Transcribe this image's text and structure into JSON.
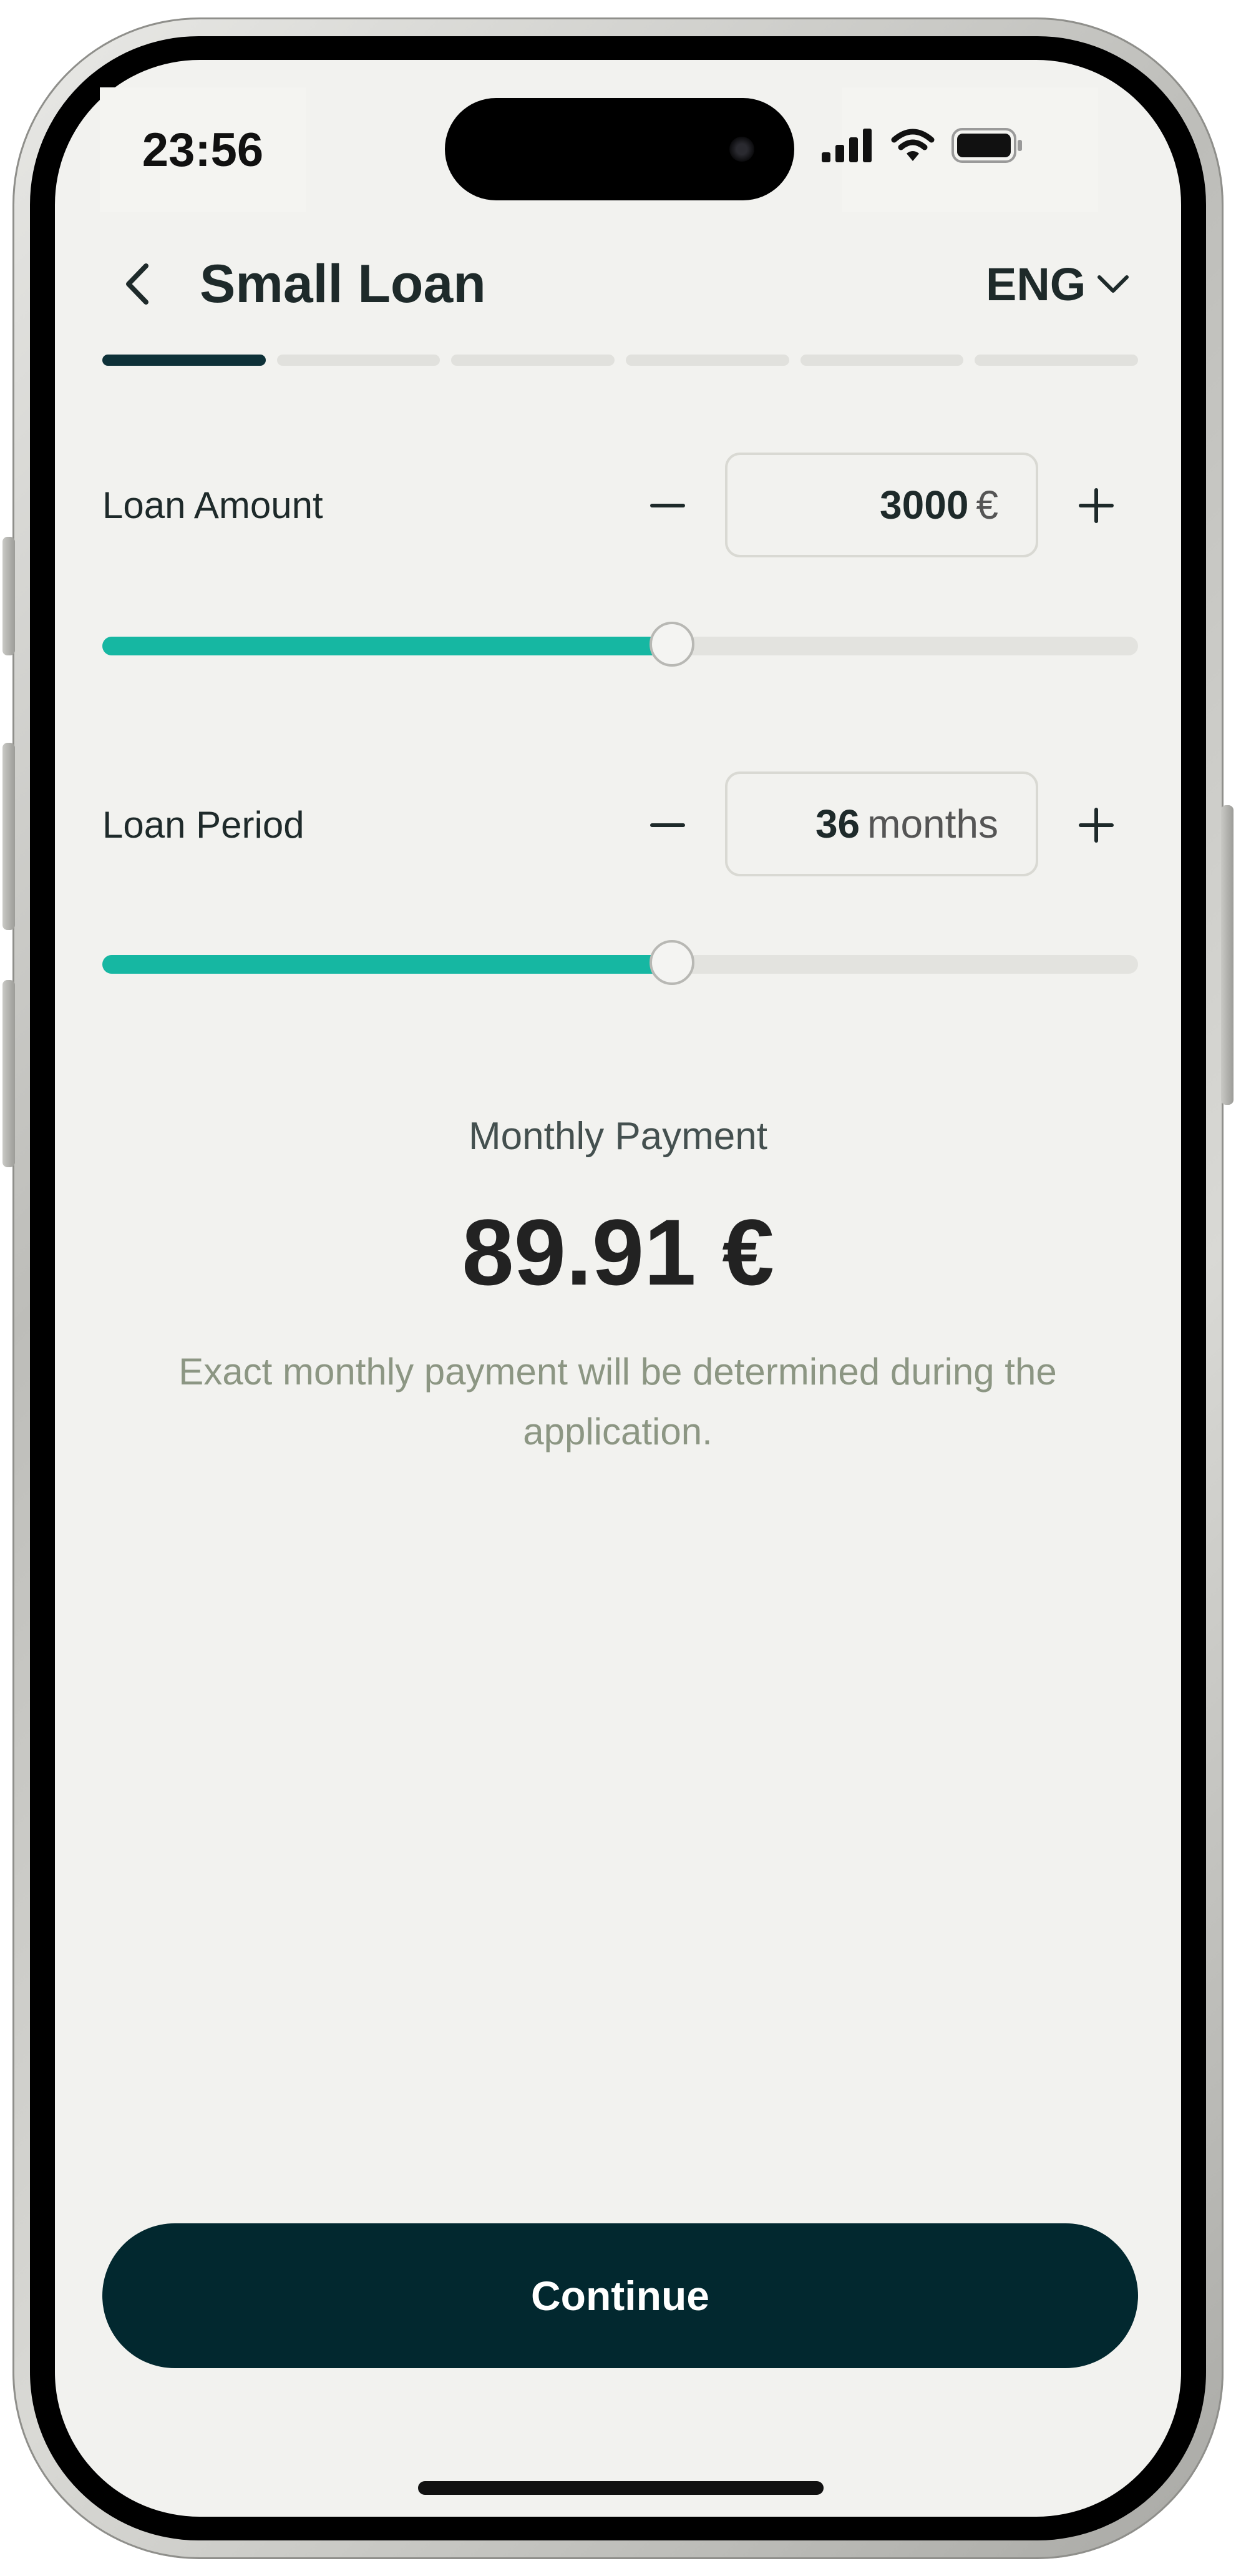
{
  "status_bar": {
    "time": "23:56"
  },
  "header": {
    "title": "Small Loan",
    "language": "ENG"
  },
  "progress": {
    "total_steps": 6,
    "current_step": 1
  },
  "loan_amount": {
    "label": "Loan Amount",
    "value": "3000",
    "unit": "€",
    "fraction": 0.55
  },
  "loan_period": {
    "label": "Loan Period",
    "value": "36",
    "unit": "months",
    "fraction": 0.55
  },
  "payment": {
    "label": "Monthly Payment",
    "value": "89.91 €",
    "disclaimer": "Exact monthly payment will be determined during the application."
  },
  "actions": {
    "continue_label": "Continue"
  },
  "colors": {
    "accent": "#16b7a2",
    "primary": "#02282f",
    "background": "#f2f2ef"
  }
}
